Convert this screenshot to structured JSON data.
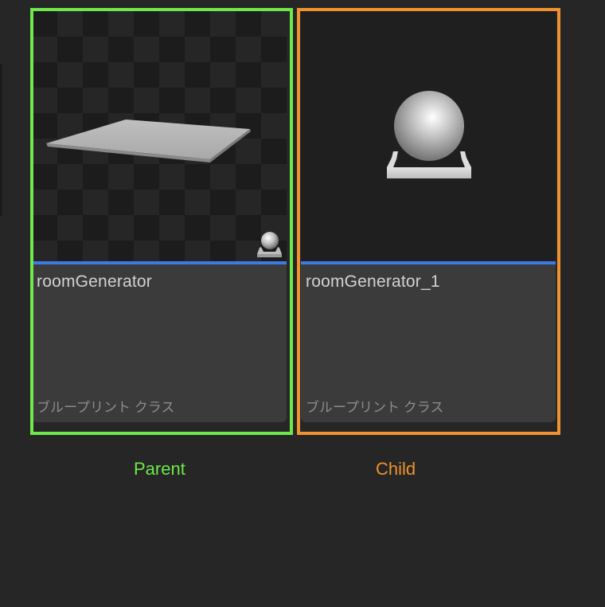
{
  "assets": [
    {
      "title": "roomGenerator",
      "type_label": "ブループリント クラス",
      "caption": "Parent",
      "highlight_color": "#6ee84a",
      "thumbnail": "flat-plane-mesh",
      "badge_icon": "actor-component-icon"
    },
    {
      "title": "roomGenerator_1",
      "type_label": "ブループリント クラス",
      "caption": "Child",
      "highlight_color": "#f0922f",
      "thumbnail": "actor-blueprint-sphere-icon"
    }
  ],
  "colors": {
    "background": "#262626",
    "card_body": "#3b3b3b",
    "accent_line": "#3d7ae6"
  }
}
